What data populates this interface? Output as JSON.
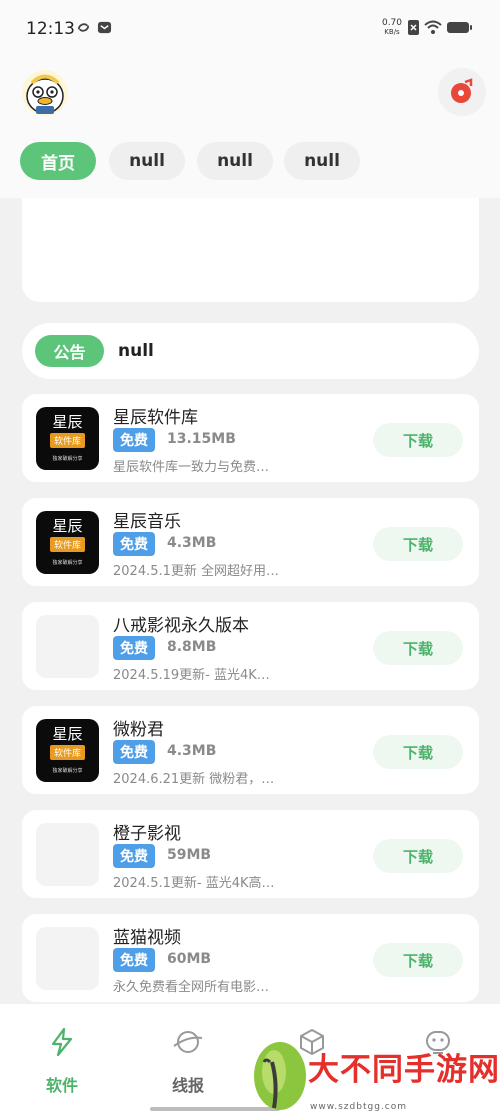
{
  "status_bar": {
    "time": "12:13",
    "speed_value": "0.70",
    "speed_unit": "KB/s"
  },
  "header": {
    "tabs": [
      {
        "label": "首页",
        "active": true
      },
      {
        "label": "null",
        "active": false
      },
      {
        "label": "null",
        "active": false
      },
      {
        "label": "null",
        "active": false
      }
    ]
  },
  "notice": {
    "badge": "公告",
    "text": "null"
  },
  "logo_text": {
    "title": "星辰",
    "tag": "软件库",
    "subtitle": "独家破解分享"
  },
  "apps": [
    {
      "name": "星辰软件库",
      "badge": "免费",
      "size": "13.15MB",
      "desc": "星辰软件库一致力与免费…",
      "button": "下载",
      "icon": "logo"
    },
    {
      "name": "星辰音乐",
      "badge": "免费",
      "size": "4.3MB",
      "desc": "2024.5.1更新 全网超好用…",
      "button": "下载",
      "icon": "logo"
    },
    {
      "name": "八戒影视永久版本",
      "badge": "免费",
      "size": "8.8MB",
      "desc": "2024.5.19更新- 蓝光4K…",
      "button": "下载",
      "icon": "blank"
    },
    {
      "name": "微粉君",
      "badge": "免费",
      "size": "4.3MB",
      "desc": "2024.6.21更新 微粉君，…",
      "button": "下载",
      "icon": "logo"
    },
    {
      "name": "橙子影视",
      "badge": "免费",
      "size": "59MB",
      "desc": "2024.5.1更新- 蓝光4K高…",
      "button": "下载",
      "icon": "blank"
    },
    {
      "name": "蓝猫视频",
      "badge": "免费",
      "size": "60MB",
      "desc": "永久免费看全网所有电影…",
      "button": "下载",
      "icon": "blank"
    }
  ],
  "bottom_nav": [
    {
      "label": "软件",
      "icon": "lightning-icon",
      "active": true
    },
    {
      "label": "线报",
      "icon": "planet-icon",
      "active": false
    },
    {
      "label": "",
      "icon": "box-icon",
      "active": false
    },
    {
      "label": "",
      "icon": "robot-icon",
      "active": false
    }
  ],
  "watermark": {
    "text": "大不同手游网",
    "url": "www.szdbtgg.com"
  },
  "colors": {
    "accent": "#5cc57a",
    "free_badge": "#4e9fe8",
    "download_text": "#4db36a",
    "watermark": "#e52f2a"
  }
}
